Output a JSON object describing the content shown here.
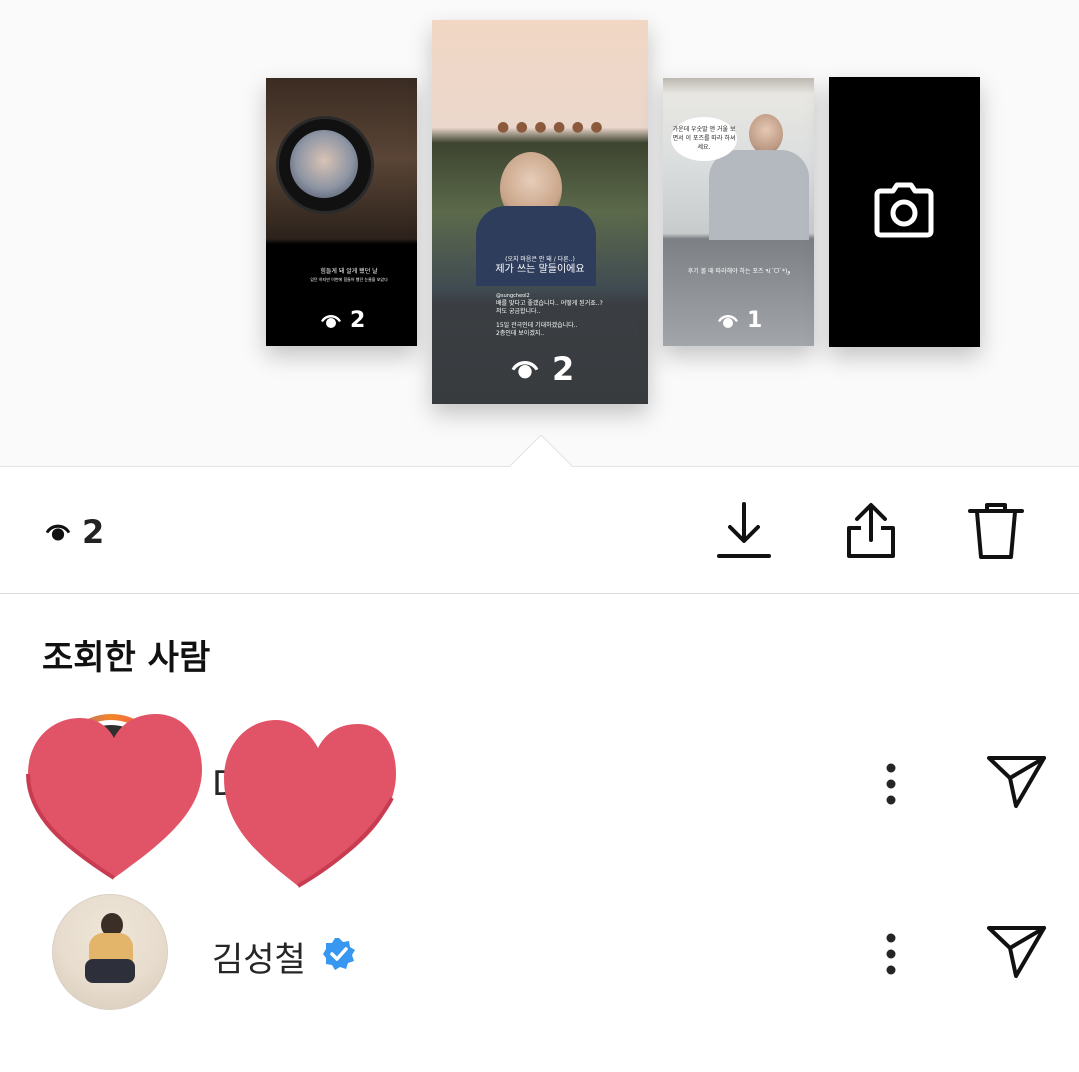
{
  "stories": [
    {
      "views": "2",
      "caption_lines": [
        "힘들게 돼 알게 됐던 날",
        "있던 하지만 이번에 힘들어 했던 눈물을 보았다"
      ]
    },
    {
      "views": "2",
      "subtitle": "(오지 마음은 안 돼 / 다른..)",
      "title": "제가 쓰는 말들이에요",
      "handle": "@sungcheol2",
      "body_lines": [
        "배를 맞다고 좋겠습니다.. 어떻게 된거죠..?",
        "저도 궁금합니다..",
        "15일 관극인데 기대하겠습니다..",
        "2층인데 보이겠지.."
      ]
    },
    {
      "views": "1",
      "bubble": "가운데 우숫말 앤 거울 보면서 이 포즈를 따라 하셔세요.",
      "caption": "후기 볼 때 따라해야 하는 포즈 ٩(ˊᗜˋ*)و"
    },
    {
      "type": "camera",
      "icon": "camera-icon"
    }
  ],
  "selected": {
    "views": "2"
  },
  "actions": [
    "download-icon",
    "share-icon",
    "trash-icon"
  ],
  "section_title": "조회한 사람",
  "viewers": [
    {
      "name": "D",
      "obscured": true
    },
    {
      "name": "김성철",
      "verified": true
    }
  ],
  "colors": {
    "heart": "#e15467",
    "verified": "#3897f0"
  }
}
